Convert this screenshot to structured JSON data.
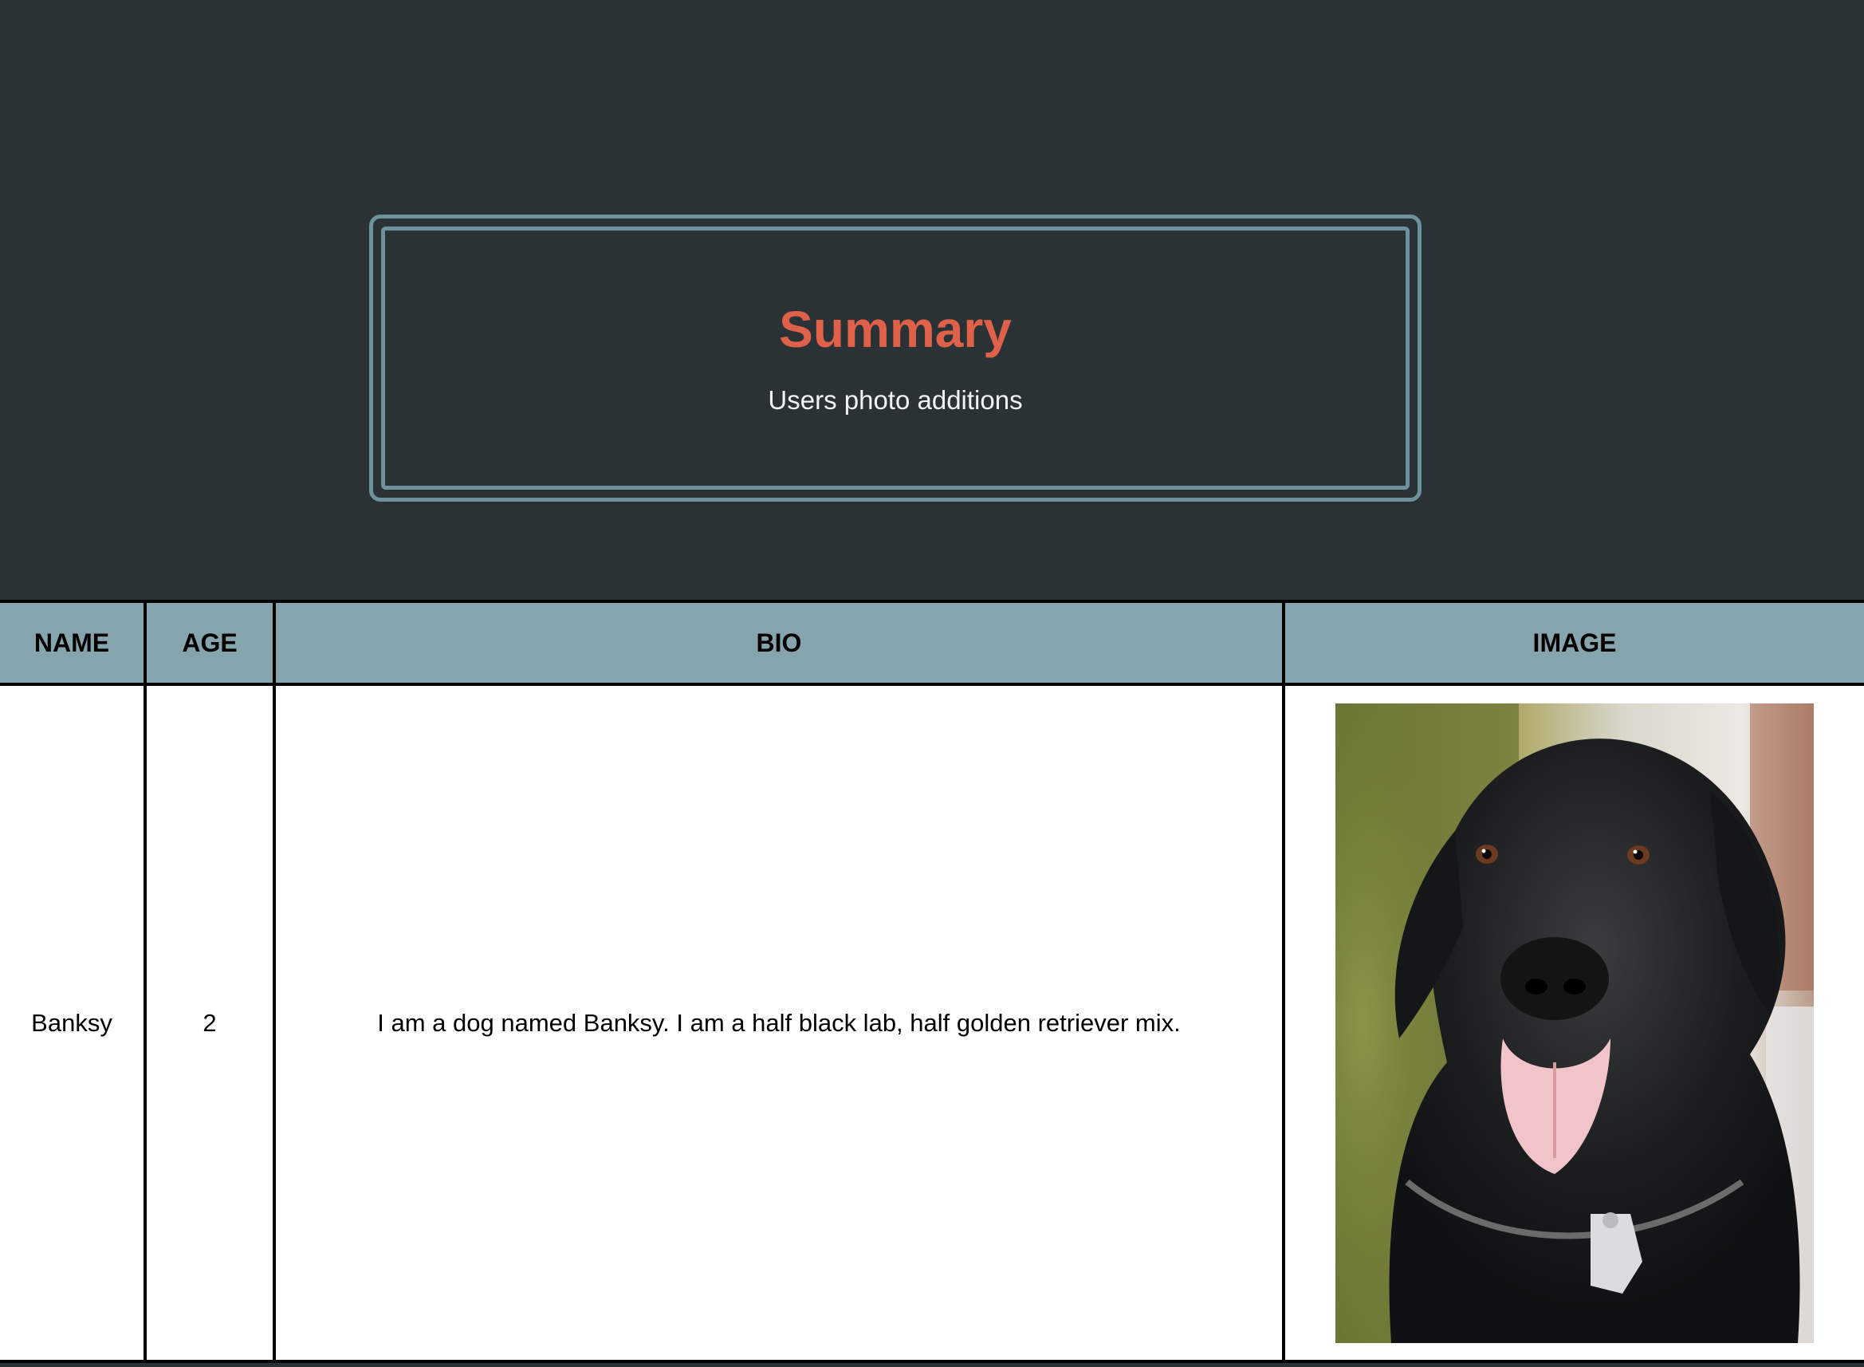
{
  "summary": {
    "title": "Summary",
    "subtitle": "Users photo additions"
  },
  "table": {
    "columns": [
      "NAME",
      "AGE",
      "BIO",
      "IMAGE"
    ],
    "rows": [
      {
        "name": "Banksy",
        "age": "2",
        "bio": "I am a dog named Banksy. I am a half black lab, half golden retriever mix.",
        "image": "black-dog-photo"
      }
    ]
  },
  "colors": {
    "background": "#2b3236",
    "accent": "#e0614a",
    "frame": "#6c929e",
    "table_header": "#86a4ad"
  }
}
